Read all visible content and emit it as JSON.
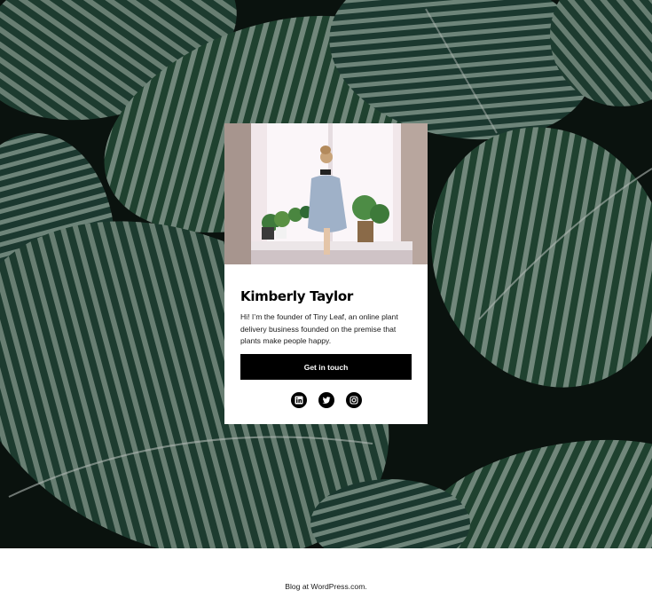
{
  "profile": {
    "name": "Kimberly Taylor",
    "bio": "Hi! I’m the founder of Tiny Leaf, an online plant delivery business founded on the premise that plants make people happy.",
    "cta_label": "Get in touch"
  },
  "social_links": [
    {
      "icon": "linkedin-icon"
    },
    {
      "icon": "twitter-icon"
    },
    {
      "icon": "instagram-icon"
    }
  ],
  "footer": {
    "text": "Blog at WordPress.com."
  },
  "colors": {
    "accent": "#000000",
    "card_background": "#ffffff",
    "leaf_dark": "#1f3a2a",
    "leaf_light": "#8fa89a"
  }
}
